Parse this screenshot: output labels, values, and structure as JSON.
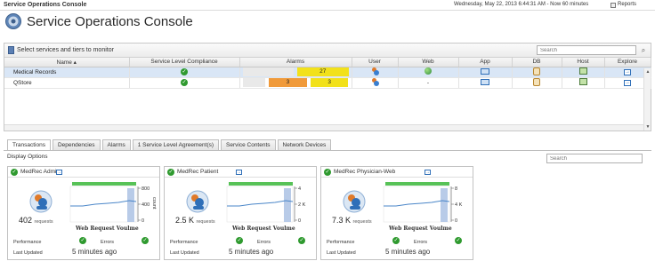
{
  "topbar": {
    "app_title": "Service Operations Console",
    "time_range": "Wednesday, May 22, 2013 6:44:31 AM - Now 60 minutes",
    "reports_label": "Reports"
  },
  "header": {
    "title": "Service Operations Console"
  },
  "tier_bar": {
    "label": "Select services and tiers to monitor",
    "search_placeholder": "Search"
  },
  "table": {
    "columns": [
      "Name",
      "Service Level Compliance",
      "Alarms",
      "User",
      "Web",
      "App",
      "DB",
      "Host",
      "Explore"
    ],
    "rows": [
      {
        "name": "Medical Records",
        "alarm_orange": "",
        "alarm_yellow": "27",
        "web": ""
      },
      {
        "name": "QStore",
        "alarm_orange": "3",
        "alarm_yellow": "3",
        "web": "-"
      }
    ]
  },
  "tabs": [
    "Transactions",
    "Dependencies",
    "Alarms",
    "1 Service Level Agreement(s)",
    "Service Contents",
    "Network Devices"
  ],
  "display_options": "Display Options",
  "card_search_placeholder": "Search",
  "cards": [
    {
      "title": "MedRec Admin",
      "value": "402",
      "unit": "requests",
      "ticks": [
        "800",
        "400",
        "0"
      ],
      "axis_label": "count",
      "chart_title": "Web Request Voulme",
      "performance_label": "Performance",
      "errors_label": "Errors",
      "last_updated_label": "Last Updated",
      "last_updated_value": "5 minutes ago"
    },
    {
      "title": "MedRec Patient",
      "value": "2.5 K",
      "unit": "requests",
      "ticks": [
        "4",
        "2 K",
        "0"
      ],
      "axis_label": "",
      "chart_title": "Web Request Voulme",
      "performance_label": "Performance",
      "errors_label": "Errors",
      "last_updated_label": "Last Updated",
      "last_updated_value": "5 minutes ago"
    },
    {
      "title": "MedRec Physician-Web",
      "value": "7.3 K",
      "unit": "requests",
      "ticks": [
        "8",
        "4 K",
        "0"
      ],
      "axis_label": "",
      "chart_title": "Web Request Voulme",
      "performance_label": "Performance",
      "errors_label": "Errors",
      "last_updated_label": "Last Updated",
      "last_updated_value": "5 minutes ago"
    }
  ],
  "colors": {
    "ok": "#2f9a2f",
    "alarm_orange": "#f09a3a",
    "alarm_yellow": "#f2e11a",
    "selected_row": "#d9e6f6",
    "status_bar": "#57c257",
    "chart_line": "#4a86c8"
  }
}
